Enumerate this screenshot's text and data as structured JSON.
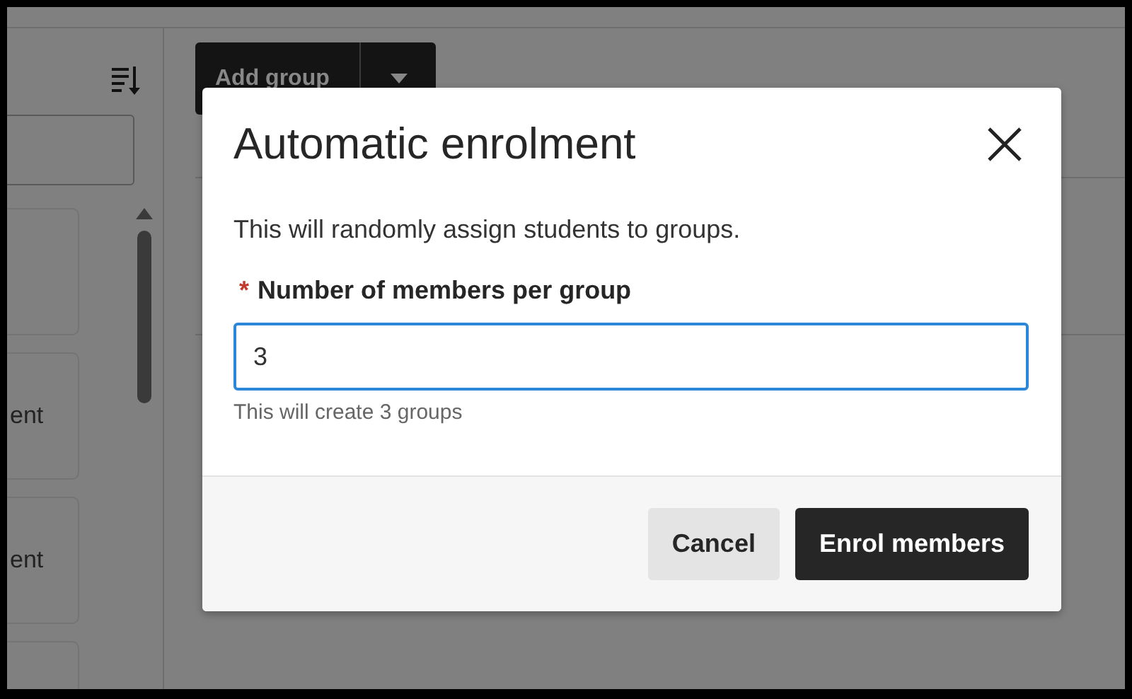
{
  "background": {
    "add_group_button": {
      "label": "Add group"
    },
    "cards": [
      {
        "kind": "blank"
      },
      {
        "kind": "text",
        "label": "ent"
      },
      {
        "kind": "text",
        "label": "ent"
      },
      {
        "kind": "blank"
      }
    ]
  },
  "dialog": {
    "title": "Automatic enrolment",
    "description": "This will randomly assign students to groups.",
    "field": {
      "label": "Number of members per group",
      "required_mark": "*",
      "value": "3",
      "hint": "This will create 3 groups"
    },
    "buttons": [
      {
        "kind": "secondary",
        "label": "Cancel"
      },
      {
        "kind": "primary",
        "label": "Enrol members"
      }
    ]
  }
}
